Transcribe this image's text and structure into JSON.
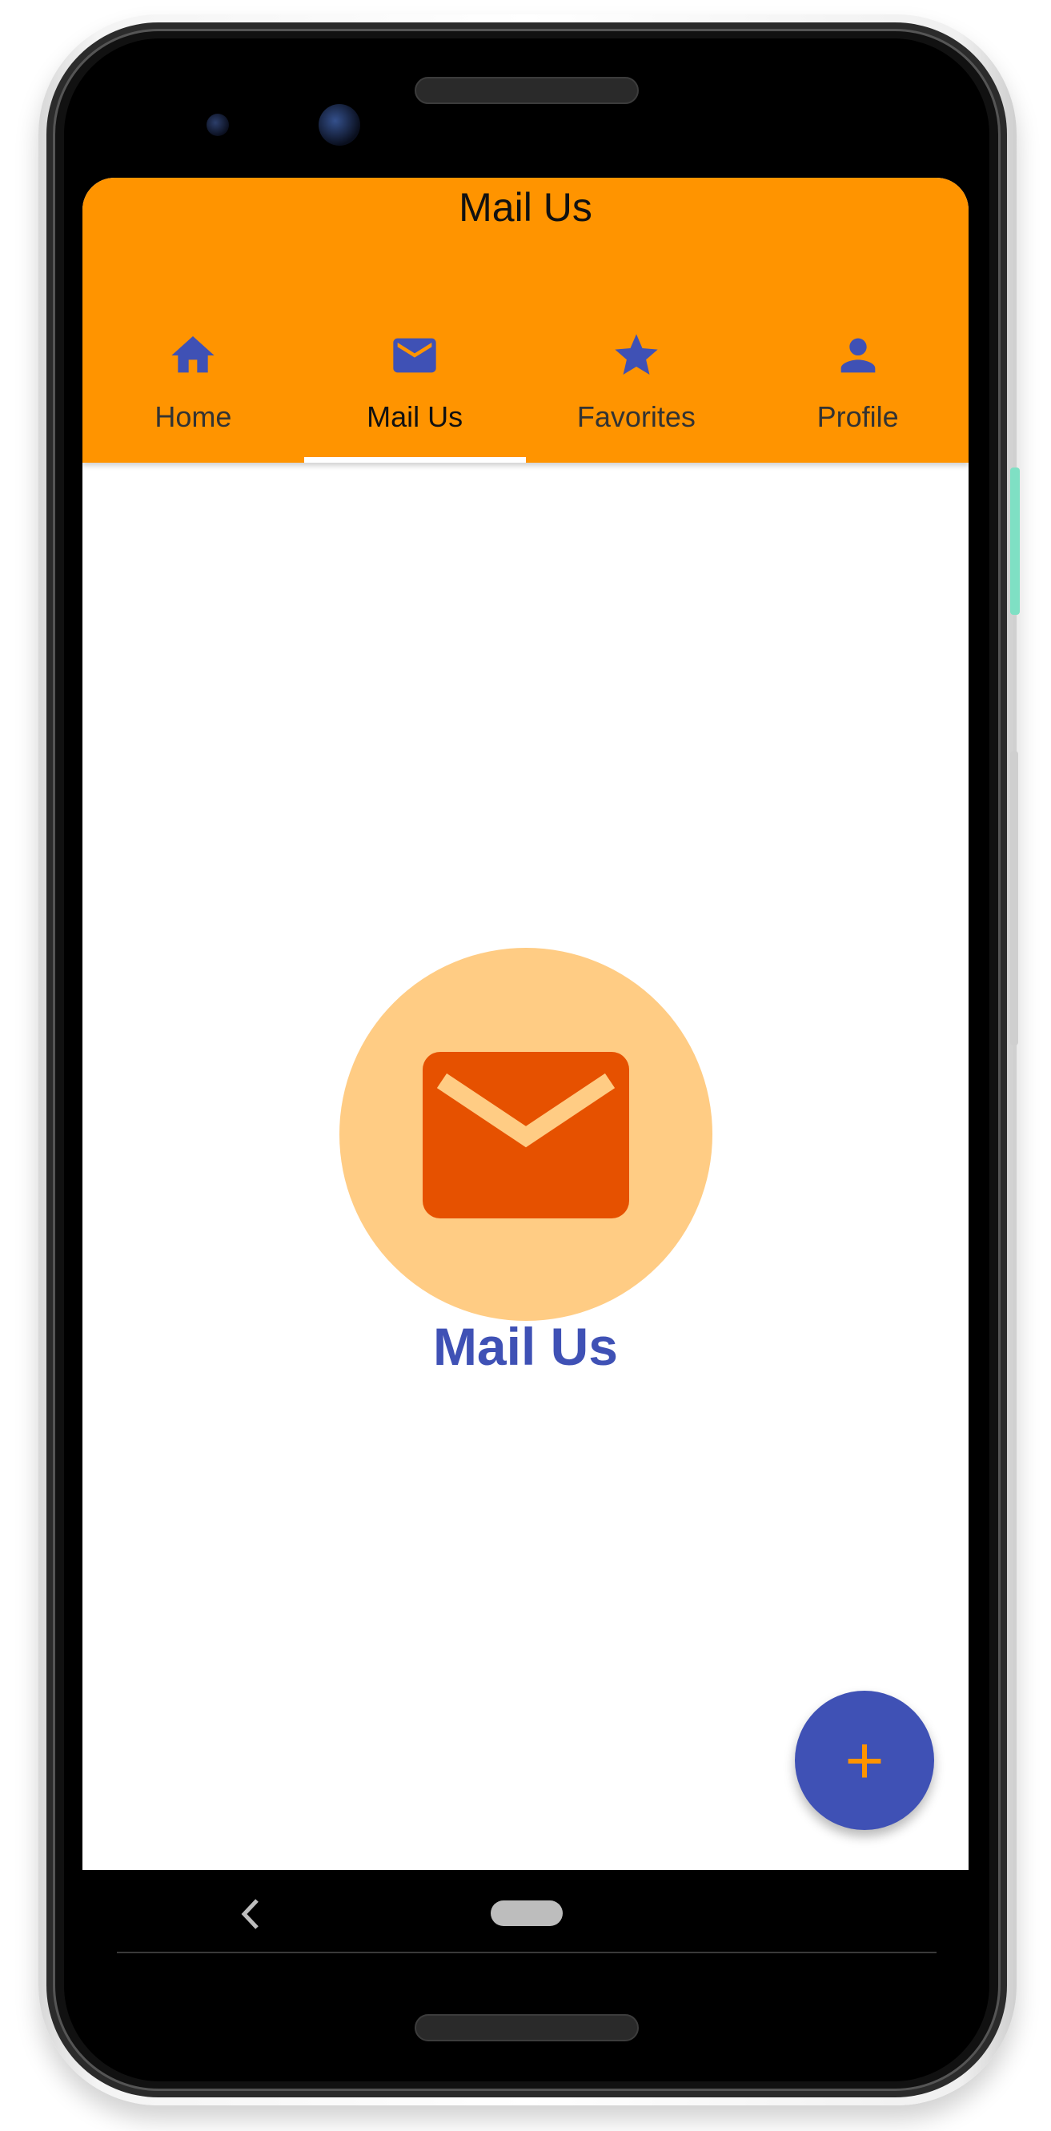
{
  "appbar": {
    "title": "Mail Us",
    "background_color": "#ff9400"
  },
  "tabs": [
    {
      "label": "Home",
      "icon": "home-icon",
      "active": false
    },
    {
      "label": "Mail Us",
      "icon": "mail-icon",
      "active": true
    },
    {
      "label": "Favorites",
      "icon": "star-icon",
      "active": false
    },
    {
      "label": "Profile",
      "icon": "person-icon",
      "active": false
    }
  ],
  "content": {
    "title": "Mail Us",
    "icon": "mail-icon",
    "circle_color": "#ffcc84",
    "icon_color": "#e65100",
    "title_color": "#3f51b5"
  },
  "fab": {
    "label": "+",
    "background_color": "#3f51b5",
    "icon_color": "#ff9400"
  },
  "navigation": {
    "back_icon": "chevron-left-icon",
    "home_icon": "home-pill-icon"
  },
  "colors": {
    "accent": "#3f51b5",
    "primary": "#ff9400"
  }
}
